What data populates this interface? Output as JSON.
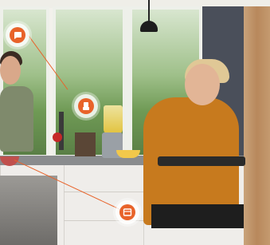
{
  "scene": {
    "description_label": "",
    "accent_color": "#e8632a"
  },
  "hotspots": [
    {
      "name": "chat-icon"
    },
    {
      "name": "blender-icon"
    },
    {
      "name": "oven-icon"
    }
  ]
}
